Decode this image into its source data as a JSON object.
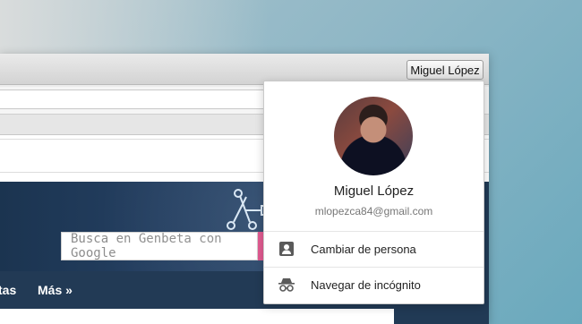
{
  "toolbar": {
    "profile_button_label": "Miguel López"
  },
  "page": {
    "search_placeholder": "Busca en Genbeta con Google",
    "nav_partial": "tas",
    "nav_more": "Más »"
  },
  "profile_menu": {
    "name": "Miguel López",
    "email": "mlopezca84@gmail.com",
    "items": [
      {
        "label": "Cambiar de persona",
        "icon": "person-icon"
      },
      {
        "label": "Navegar de incógnito",
        "icon": "incognito-icon"
      }
    ]
  },
  "colors": {
    "header_blue": "#223a55",
    "pink_accent": "#e0508a"
  }
}
